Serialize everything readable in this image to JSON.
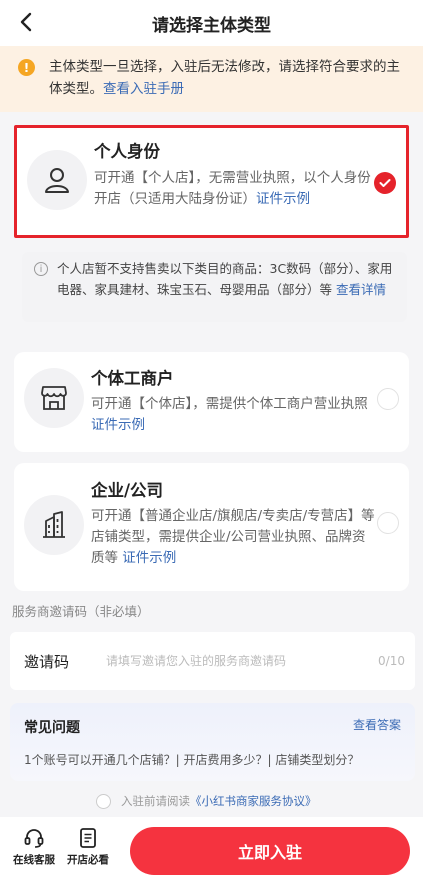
{
  "header": {
    "title": "请选择主体类型"
  },
  "notice": {
    "text": "主体类型一旦选择，入驻后无法修改，请选择符合要求的主体类型。",
    "link": "查看入驻手册"
  },
  "options": [
    {
      "title": "个人身份",
      "desc": "可开通【个人店】，无需营业执照，以个人身份开店（只适用大陆身份证）",
      "link": "证件示例",
      "selected": true
    },
    {
      "title": "个体工商户",
      "desc": "可开通【个体店】，需提供个体工商户营业执照",
      "link": "证件示例",
      "selected": false
    },
    {
      "title": "企业/公司",
      "desc": "可开通【普通企业店/旗舰店/专卖店/专营店】等店铺类型，需提供企业/公司营业执照、品牌资质等",
      "link": "证件示例",
      "selected": false
    }
  ],
  "info": {
    "text": "个人店暂不支持售卖以下类目的商品：3C数码（部分）、家用电器、家具建材、珠宝玉石、母婴用品（部分）等",
    "link": "查看详情"
  },
  "invite": {
    "section_label": "服务商邀请码（非必填）",
    "label": "邀请码",
    "placeholder": "请填写邀请您入驻的服务商邀请码",
    "count": "0/10"
  },
  "faq": {
    "title": "常见问题",
    "more": "查看答案",
    "questions": "1个账号可以开通几个店铺？| 开店费用多少？| 店铺类型划分？"
  },
  "agreement": {
    "prefix": "入驻前请阅读",
    "link": "《小红书商家服务协议》"
  },
  "bottom": {
    "service": "在线客服",
    "guide": "开店必看",
    "cta": "立即入驻"
  },
  "colors": {
    "accent": "#e5232b",
    "link": "#3b6bb5",
    "warning": "#f5a623"
  }
}
